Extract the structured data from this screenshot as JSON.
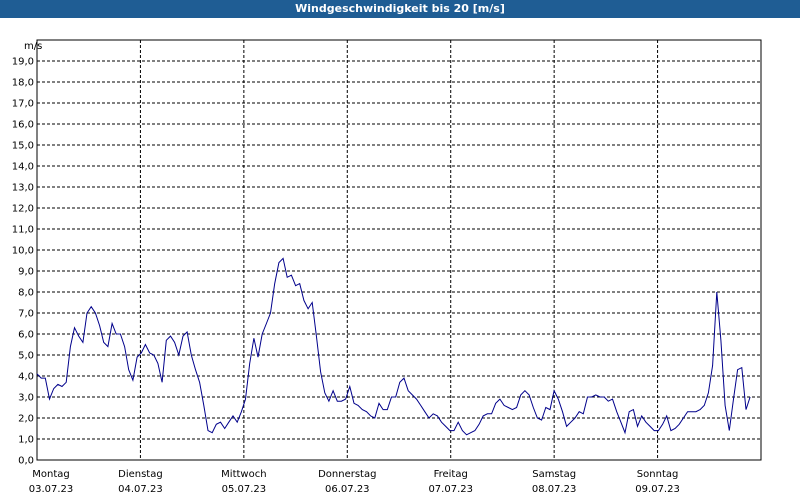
{
  "chart_data": {
    "type": "line",
    "title": "Windgeschwindigkeit bis 20 [m/s]",
    "ylabel": "m/s",
    "ylim": [
      0,
      20
    ],
    "yticks": [
      "0,0",
      "1,0",
      "2,0",
      "3,0",
      "4,0",
      "5,0",
      "6,0",
      "7,0",
      "8,0",
      "9,0",
      "10,0",
      "11,0",
      "12,0",
      "13,0",
      "14,0",
      "15,0",
      "16,0",
      "17,0",
      "18,0",
      "19,0"
    ],
    "xlim": [
      0,
      7
    ],
    "xticks": [
      {
        "day": "Montag",
        "date": "03.07.23"
      },
      {
        "day": "Dienstag",
        "date": "04.07.23"
      },
      {
        "day": "Mittwoch",
        "date": "05.07.23"
      },
      {
        "day": "Donnerstag",
        "date": "06.07.23"
      },
      {
        "day": "Freitag",
        "date": "07.07.23"
      },
      {
        "day": "Samstag",
        "date": "08.07.23"
      },
      {
        "day": "Sonntag",
        "date": "09.07.23"
      }
    ],
    "grid": true,
    "line_color": "#00008b",
    "series": [
      {
        "values": [
          4.1,
          3.9,
          3.9,
          2.9,
          3.4,
          3.6,
          3.5,
          3.7,
          5.4,
          6.3,
          5.9,
          5.6,
          7.0,
          7.3,
          7.0,
          6.4,
          5.6,
          5.4,
          6.5,
          6.0,
          6.0,
          5.4,
          4.3,
          3.8,
          4.9,
          5.1,
          5.5,
          5.1,
          5.0,
          4.6,
          3.7,
          5.7,
          5.9,
          5.6,
          5.0,
          5.9,
          6.1,
          5.0,
          4.3,
          3.7,
          2.6,
          1.4,
          1.3,
          1.7,
          1.8,
          1.5,
          1.8,
          2.1,
          1.8,
          2.3,
          2.9,
          4.6,
          5.8,
          4.9,
          6.0,
          6.5,
          7.0,
          8.4,
          9.4,
          9.6,
          8.7,
          8.8,
          8.3,
          8.4,
          7.6,
          7.2,
          7.5,
          5.9,
          4.2,
          3.2,
          2.8,
          3.3,
          2.8,
          2.8,
          2.9,
          3.5,
          2.7,
          2.6,
          2.4,
          2.3,
          2.1,
          2.0,
          2.7,
          2.4,
          2.4,
          3.0,
          3.0,
          3.7,
          3.9,
          3.3,
          3.1,
          2.9,
          2.6,
          2.3,
          2.0,
          2.2,
          2.1,
          1.8,
          1.6,
          1.4,
          1.4,
          1.8,
          1.4,
          1.2,
          1.3,
          1.4,
          1.7,
          2.1,
          2.2,
          2.2,
          2.7,
          2.9,
          2.6,
          2.5,
          2.4,
          2.5,
          3.1,
          3.3,
          3.1,
          2.5,
          2.0,
          1.9,
          2.5,
          2.4,
          3.3,
          2.9,
          2.3,
          1.6,
          1.8,
          2.0,
          2.3,
          2.2,
          3.0,
          3.0,
          3.1,
          3.0,
          3.0,
          2.8,
          2.9,
          2.3,
          1.8,
          1.3,
          2.3,
          2.4,
          1.6,
          2.1,
          1.8,
          1.6,
          1.4,
          1.4,
          1.7,
          2.1,
          1.4,
          1.5,
          1.7,
          2.0,
          2.3,
          2.3,
          2.3,
          2.4,
          2.6,
          3.2,
          4.5,
          8.0,
          5.7,
          2.6,
          1.4,
          2.9,
          4.3,
          4.4,
          2.4,
          3.0
        ]
      }
    ]
  }
}
